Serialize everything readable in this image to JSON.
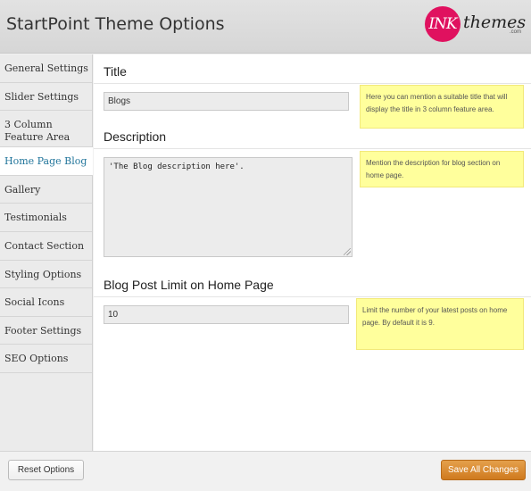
{
  "header": {
    "title": "StartPoint Theme Options",
    "logo_ink": "INK",
    "logo_themes": "themes",
    "logo_dotcom": ".com"
  },
  "sidebar": {
    "items": [
      {
        "label": "General Settings"
      },
      {
        "label": "Slider Settings"
      },
      {
        "label": "3 Column Feature Area"
      },
      {
        "label": "Home Page Blog"
      },
      {
        "label": "Gallery"
      },
      {
        "label": "Testimonials"
      },
      {
        "label": "Contact Section"
      },
      {
        "label": "Styling Options"
      },
      {
        "label": "Social Icons"
      },
      {
        "label": "Footer Settings"
      },
      {
        "label": "SEO Options"
      }
    ],
    "active_item": "Home Page Blog"
  },
  "main": {
    "title_section": {
      "heading": "Title",
      "value": "Blogs",
      "help": "Here you can mention a suitable title that will display the title in 3 column feature area."
    },
    "description_section": {
      "heading": "Description",
      "value": "'The Blog description here'.",
      "help": "Mention the description for blog section on home page."
    },
    "limit_section": {
      "heading": "Blog Post Limit on Home Page",
      "value": "10",
      "help": "Limit the number of your latest posts on home page. By default it is 9."
    }
  },
  "footer": {
    "reset_label": "Reset Options",
    "save_label": "Save All Changes"
  },
  "colors": {
    "accent": "#21759b",
    "save_button": "#d9882f",
    "help_background": "#ffff9c"
  }
}
